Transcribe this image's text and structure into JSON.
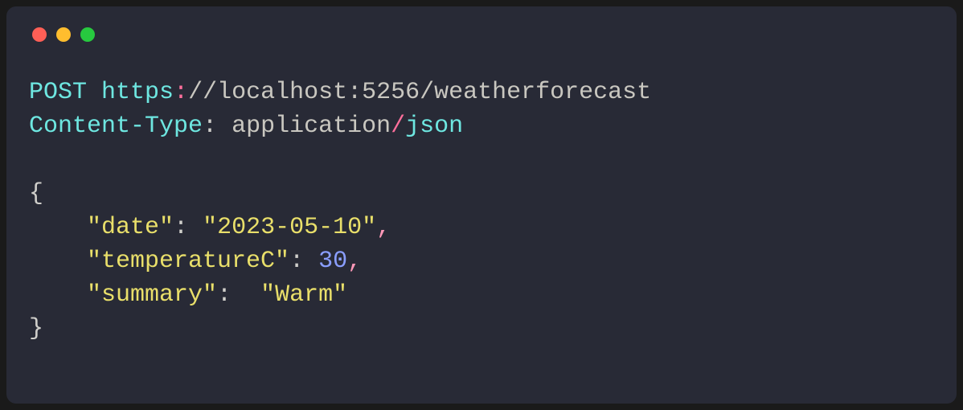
{
  "request": {
    "method": "POST",
    "proto": "https",
    "url_rest": "//localhost:5256/weatherforecast",
    "header_name": "Content-Type",
    "header_sep": ": ",
    "mime_left": "application",
    "mime_right": "json"
  },
  "body": {
    "open_brace": "{",
    "close_brace": "}",
    "indent": "    ",
    "k_date": "\"date\"",
    "v_date": "\"2023-05-10\"",
    "k_temp": "\"temperatureC\"",
    "v_temp": "30",
    "k_summary": "\"summary\"",
    "v_summary": "\"Warm\"",
    "colon": ": ",
    "colon2": ":  ",
    "comma": ","
  }
}
